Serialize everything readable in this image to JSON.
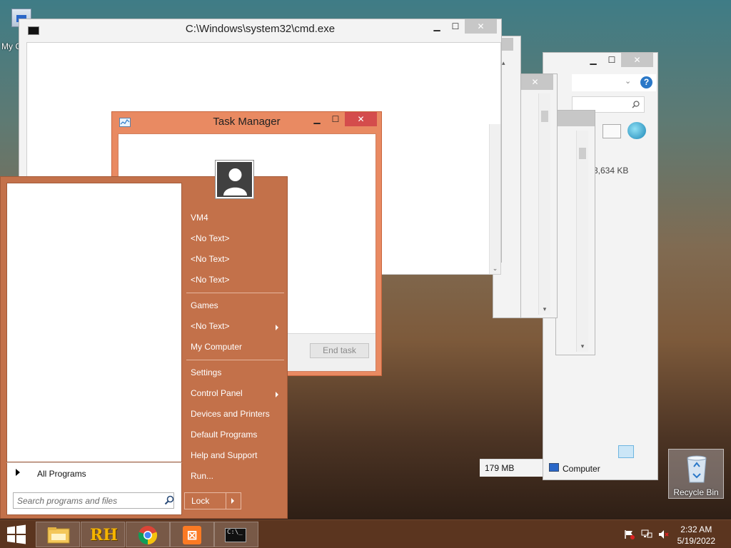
{
  "desktop": {
    "icons": {
      "my_computer": "My C",
      "recycle_bin": "Recycle Bin"
    }
  },
  "windows": {
    "cmd": {
      "title": "C:\\Windows\\system32\\cmd.exe"
    },
    "task_manager": {
      "title": "Task Manager",
      "end_task": "End task"
    },
    "explorer": {
      "memory_fragment": "3,634 KB",
      "status_size": "179 MB",
      "status_location": "Computer"
    }
  },
  "start_menu": {
    "all_programs": "All Programs",
    "search_placeholder": "Search programs and files",
    "right_items": [
      "VM4",
      "<No Text>",
      "<No Text>",
      "<No Text>",
      "Games",
      "<No Text>",
      "My Computer",
      "Settings",
      "Control Panel",
      "Devices and Printers",
      "Default Programs",
      "Help and Support",
      "Run..."
    ],
    "lock": "Lock"
  },
  "taskbar": {
    "apps": [
      "file-explorer-icon",
      "rh-icon",
      "chrome-icon",
      "xampp-icon",
      "cmd-icon"
    ],
    "clock": {
      "time": "2:32 AM",
      "date": "5/19/2022"
    }
  },
  "colors": {
    "accent": "#c3714a",
    "task_manager_frame": "#e98a62",
    "close_button": "#d44c4c"
  }
}
